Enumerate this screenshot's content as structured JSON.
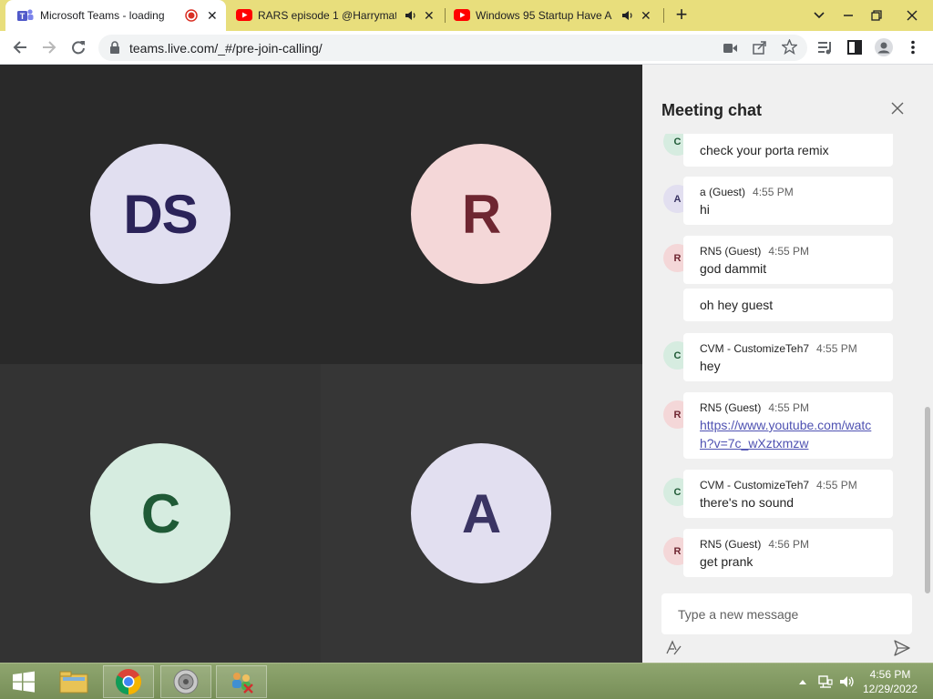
{
  "browser": {
    "tabs": [
      {
        "title": "Microsoft Teams - loading",
        "icon": "teams-icon"
      },
      {
        "title": "RARS episode 1 @Harrymat",
        "icon": "youtube-icon"
      },
      {
        "title": "Windows 95 Startup Have A",
        "icon": "youtube-icon"
      }
    ],
    "url": "teams.live.com/_#/pre-join-calling/"
  },
  "participants": [
    {
      "initials": "DS",
      "bg": "#e1dff0",
      "fg": "#2b2359"
    },
    {
      "initials": "R",
      "bg": "#f4d7d8",
      "fg": "#6e2631"
    },
    {
      "initials": "C",
      "bg": "#d6ece0",
      "fg": "#1f5a36"
    },
    {
      "initials": "A",
      "bg": "#e2dff0",
      "fg": "#3a3463"
    }
  ],
  "chat": {
    "title": "Meeting chat",
    "messages": [
      {
        "initial": "C",
        "sender": "",
        "time": "",
        "text": "check your porta remix"
      },
      {
        "initial": "A",
        "sender": "a (Guest)",
        "time": "4:55 PM",
        "text": "hi"
      },
      {
        "initial": "R",
        "sender": "RN5 (Guest)",
        "time": "4:55 PM",
        "text": "god dammit"
      },
      {
        "initial": "",
        "sender": "",
        "time": "",
        "text": "oh hey guest"
      },
      {
        "initial": "C",
        "sender": "CVM - CustomizeTeh7",
        "time": "4:55 PM",
        "text": "hey"
      },
      {
        "initial": "R",
        "sender": "RN5 (Guest)",
        "time": "4:55 PM",
        "text": "https://www.youtube.com/watch?v=7c_wXztxmzw"
      },
      {
        "initial": "C",
        "sender": "CVM - CustomizeTeh7",
        "time": "4:55 PM",
        "text": "there's no sound"
      },
      {
        "initial": "R",
        "sender": "RN5 (Guest)",
        "time": "4:56 PM",
        "text": "get prank"
      }
    ],
    "compose_placeholder": "Type a new message"
  },
  "taskbar": {
    "time": "4:56 PM",
    "date": "12/29/2022"
  },
  "colors": {
    "tabstrip": "#e8de7c",
    "tile_dark": "#292929",
    "tile_mid": "#333333",
    "link": "#4f52b2"
  }
}
